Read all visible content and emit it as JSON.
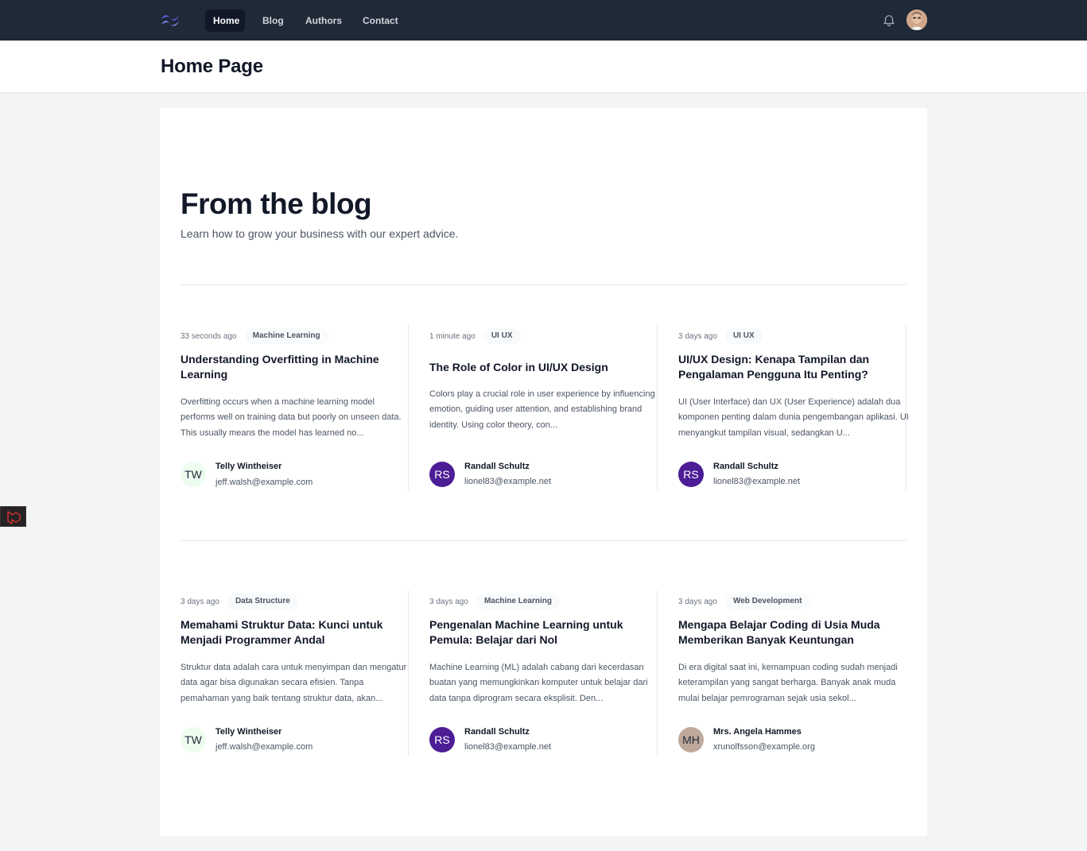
{
  "navbar": {
    "logo_icon": "tailwind-logo-icon",
    "links": [
      {
        "label": "Home",
        "active": true
      },
      {
        "label": "Blog",
        "active": false
      },
      {
        "label": "Authors",
        "active": false
      },
      {
        "label": "Contact",
        "active": false
      }
    ],
    "notification_icon": "bell-icon",
    "user_avatar_icon": "user-avatar",
    "colors": {
      "background": "#1f2937",
      "active_background": "#111827"
    }
  },
  "header": {
    "title": "Home Page"
  },
  "blog": {
    "heading": "From the blog",
    "subtitle": "Learn how to grow your business with our expert advice.",
    "posts": [
      {
        "date": "33 seconds ago",
        "category": "Machine Learning",
        "title": "Understanding Overfitting in Machine Learning",
        "excerpt": "Overfitting occurs when a machine learning model performs well on training data but poorly on unseen data. This usually means the model has learned no...",
        "author": {
          "initials": "TW",
          "name": "Telly Wintheiser",
          "email": "jeff.walsh@example.com",
          "bg": "#ecfdf0",
          "fg": "#1f2937"
        }
      },
      {
        "date": "1 minute ago",
        "category": "UI UX",
        "title": "The Role of Color in UI/UX Design",
        "excerpt": "Colors play a crucial role in user experience by influencing emotion, guiding user attention, and establishing brand identity. Using color theory, con...",
        "author": {
          "initials": "RS",
          "name": "Randall Schultz",
          "email": "lionel83@example.net",
          "bg": "#4c1d95",
          "fg": "#ffffff"
        }
      },
      {
        "date": "3 days ago",
        "category": "UI UX",
        "title": "UI/UX Design: Kenapa Tampilan dan Pengalaman Pengguna Itu Penting?",
        "excerpt": "UI (User Interface) dan UX (User Experience) adalah dua komponen penting dalam dunia pengembangan aplikasi. UI menyangkut tampilan visual, sedangkan U...",
        "author": {
          "initials": "RS",
          "name": "Randall Schultz",
          "email": "lionel83@example.net",
          "bg": "#4c1d95",
          "fg": "#ffffff"
        }
      },
      {
        "date": "3 days ago",
        "category": "Data Structure",
        "title": "Memahami Struktur Data: Kunci untuk Menjadi Programmer Andal",
        "excerpt": "Struktur data adalah cara untuk menyimpan dan mengatur data agar bisa digunakan secara efisien. Tanpa pemahaman yang baik tentang struktur data, akan...",
        "author": {
          "initials": "TW",
          "name": "Telly Wintheiser",
          "email": "jeff.walsh@example.com",
          "bg": "#ecfdf0",
          "fg": "#1f2937"
        }
      },
      {
        "date": "3 days ago",
        "category": "Machine Learning",
        "title": "Pengenalan Machine Learning untuk Pemula: Belajar dari Nol",
        "excerpt": "Machine Learning (ML) adalah cabang dari kecerdasan buatan yang memungkinkan komputer untuk belajar dari data tanpa diprogram secara eksplisit. Den...",
        "author": {
          "initials": "RS",
          "name": "Randall Schultz",
          "email": "lionel83@example.net",
          "bg": "#4c1d95",
          "fg": "#ffffff"
        }
      },
      {
        "date": "3 days ago",
        "category": "Web Development",
        "title": "Mengapa Belajar Coding di Usia Muda Memberikan Banyak Keuntungan",
        "excerpt": "Di era digital saat ini, kemampuan coding sudah menjadi keterampilan yang sangat berharga. Banyak anak muda mulai belajar pemrograman sejak usia sekol...",
        "author": {
          "initials": "MH",
          "name": "Mrs. Angela Hammes",
          "email": "xrunolfsson@example.org",
          "bg": "#bfa89c",
          "fg": "#1f2937"
        }
      }
    ]
  },
  "debug_icon": "laravel-icon"
}
